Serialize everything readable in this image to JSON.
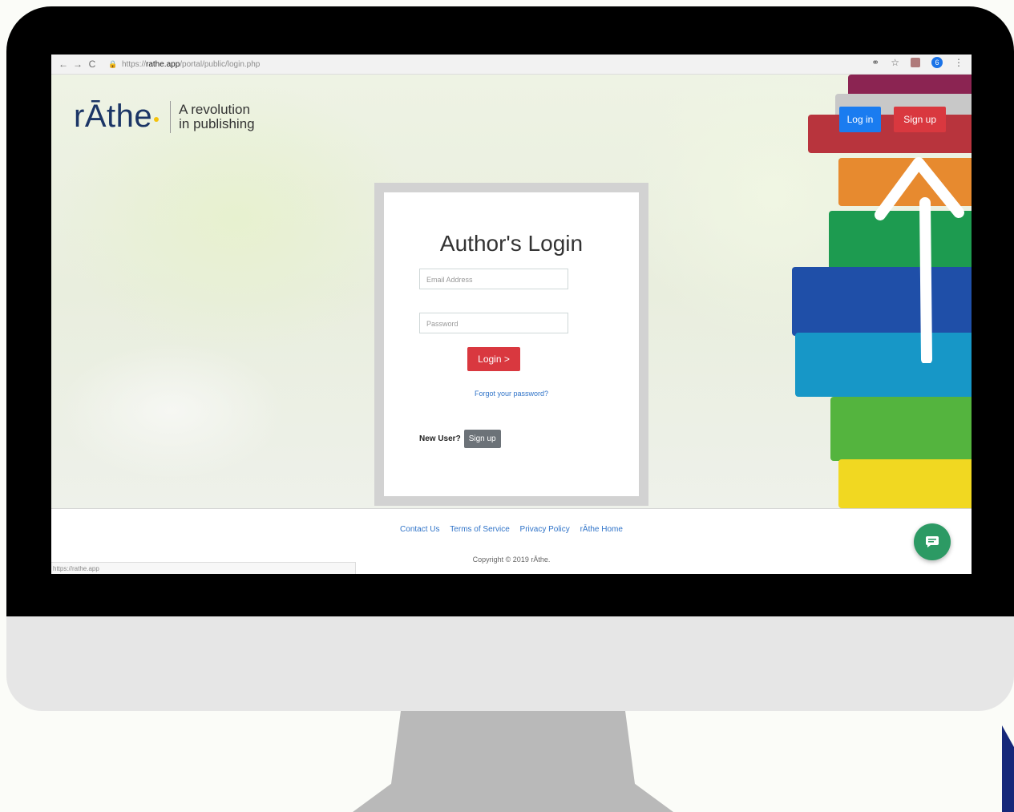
{
  "browser": {
    "back": "←",
    "forward": "→",
    "reload": "C",
    "url_prefix": "https://",
    "url_domain": "rathe.app",
    "url_path": "/portal/public/login.php",
    "profile_initial": "6"
  },
  "brand": {
    "logo": "rĀthe",
    "tagline_line1": "A revolution",
    "tagline_line2": "in publishing"
  },
  "top_nav": {
    "login_label": "Log in",
    "signup_label": "Sign up"
  },
  "login_card": {
    "title": "Author's Login",
    "email_placeholder": "Email Address",
    "password_placeholder": "Password",
    "login_button": "Login >",
    "forgot_link": "Forgot your password?",
    "new_user_label": "New User?",
    "signup_button": "Sign up"
  },
  "footer": {
    "links": [
      "Contact Us",
      "Terms of Service",
      "Privacy Policy",
      "rĀthe Home"
    ],
    "copyright": "Copyright © 2019 rĀthe.",
    "status_url": "https://rathe.app"
  },
  "colors": {
    "primary_red": "#d9383f",
    "primary_blue": "#1a7cf0",
    "chat_green": "#2c9a64"
  }
}
